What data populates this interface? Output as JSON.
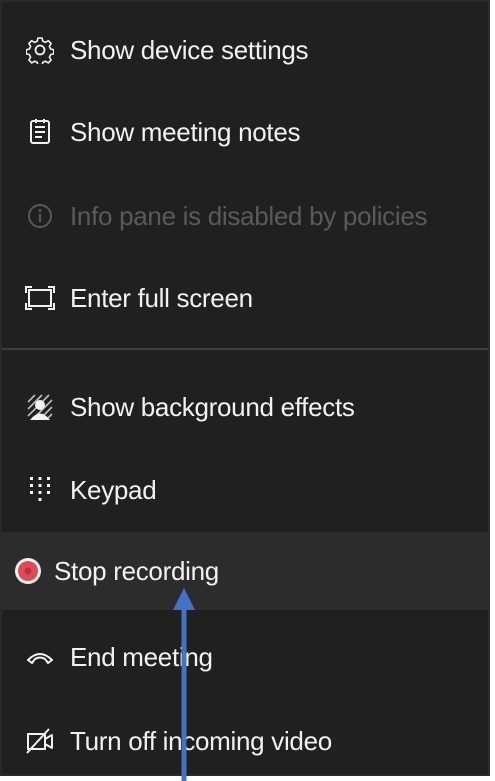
{
  "menu": {
    "items": [
      {
        "label": "Show device settings",
        "icon": "gear-icon"
      },
      {
        "label": "Show meeting notes",
        "icon": "notes-icon"
      },
      {
        "label": "Info pane is disabled by policies",
        "icon": "info-icon",
        "disabled": true
      },
      {
        "label": "Enter full screen",
        "icon": "fullscreen-icon"
      },
      {
        "label": "Show background effects",
        "icon": "background-effects-icon"
      },
      {
        "label": "Keypad",
        "icon": "keypad-icon"
      },
      {
        "label": "Stop recording",
        "icon": "record-icon"
      },
      {
        "label": "End meeting",
        "icon": "hang-up-icon"
      },
      {
        "label": "Turn off incoming video",
        "icon": "video-off-icon"
      }
    ]
  },
  "colors": {
    "menu_background": "#202020",
    "highlight": "#2c2c2c",
    "text": "#f2f2f2",
    "disabled_text": "#5a5a5a",
    "record_red": "#e04a56",
    "annotation_arrow": "#4472c4"
  }
}
